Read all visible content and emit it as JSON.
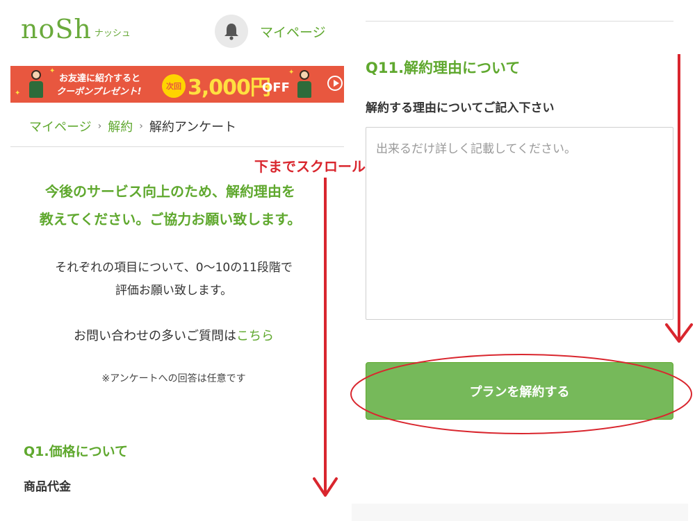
{
  "header": {
    "logo_main": "noSh",
    "logo_sub": "ナッシュ",
    "mypage_link": "マイページ"
  },
  "banner": {
    "line1": "お友達に紹介すると",
    "line2": "クーポンプレゼント!",
    "badge": "次回",
    "amount": "3,000円",
    "off": "OFF"
  },
  "breadcrumb": {
    "items": [
      "マイページ",
      "解約"
    ],
    "current": "解約アンケート"
  },
  "survey": {
    "heading_line1": "今後のサービス向上のため、解約理由を",
    "heading_line2": "教えてください。ご協力お願い致します。",
    "intro_line1": "それぞれの項目について、0〜10の11段階で",
    "intro_line2": "評価お願い致します。",
    "faq_text": "お問い合わせの多いご質問は",
    "faq_link": "こちら",
    "note": "※アンケートへの回答は任意です",
    "q1_title": "Q1.価格について",
    "q1_item": "商品代金",
    "q11_title": "Q11.解約理由について",
    "q11_label": "解約する理由についてご記入下さい",
    "q11_value": "",
    "q11_placeholder": "出来るだけ詳しく記載してください。",
    "cancel_button": "プランを解約する"
  },
  "annotation": {
    "scroll_label": "下までスクロール"
  },
  "colors": {
    "brand_green": "#5fa82e",
    "button_green": "#76b95a",
    "banner_red": "#e8573f",
    "annotation_red": "#d9262e"
  }
}
